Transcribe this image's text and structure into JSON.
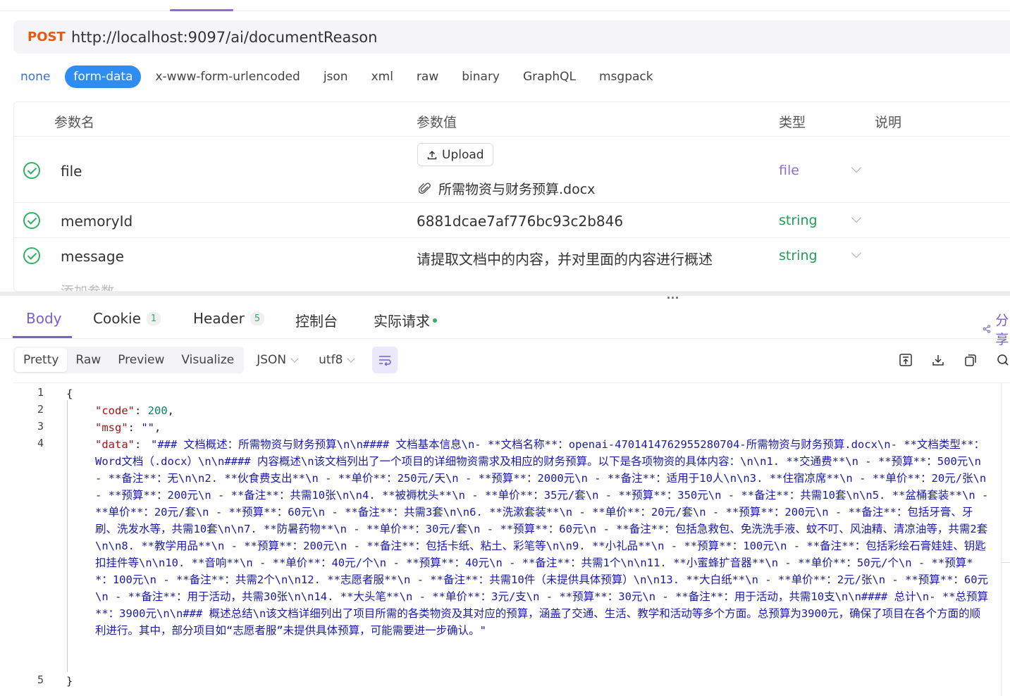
{
  "request": {
    "method": "POST",
    "url": "http://localhost:9097/ai/documentReason"
  },
  "body_types": [
    "none",
    "form-data",
    "x-www-form-urlencoded",
    "json",
    "xml",
    "raw",
    "binary",
    "GraphQL",
    "msgpack"
  ],
  "active_body_type": "form-data",
  "param_table": {
    "headers": {
      "name": "参数名",
      "value": "参数值",
      "type": "类型",
      "desc": "说明"
    },
    "rows": [
      {
        "name": "file",
        "upload_label": "Upload",
        "file_name": "所需物资与财务预算.docx",
        "type": "file"
      },
      {
        "name": "memoryId",
        "value": "6881dcae7af776bc93c2b846",
        "type": "string"
      },
      {
        "name": "message",
        "value": "请提取文档中的内容，并对里面的内容进行概述",
        "type": "string"
      }
    ],
    "add_placeholder": "添加参数"
  },
  "splitter_dots": "...",
  "response_tabs": {
    "body": "Body",
    "cookie": "Cookie",
    "cookie_count": "1",
    "header": "Header",
    "header_count": "5",
    "console": "控制台",
    "actual_request": "实际请求",
    "share": "分享"
  },
  "view_modes": [
    "Pretty",
    "Raw",
    "Preview",
    "Visualize"
  ],
  "active_view": "Pretty",
  "format": "JSON",
  "encoding": "utf8",
  "icons": [
    "top-icon",
    "download-icon",
    "copy-icon",
    "search-icon",
    "share-icon",
    "wrap-icon",
    "upload-icon",
    "paperclip-icon"
  ],
  "colors": {
    "accent": "#7b5fcf",
    "method": "#e8590c",
    "active_pill": "#2f8cf0",
    "ok": "#2fb063"
  },
  "code": {
    "line_numbers": [
      "1",
      "2",
      "3",
      "4",
      "5"
    ],
    "open_brace": "{",
    "close_brace": "}",
    "code_key": "\"code\"",
    "code_value": "200",
    "msg_key": "\"msg\"",
    "msg_value": "\"\"",
    "data_key": "\"data\"",
    "data_value": "\"### 文档概述：所需物资与财务预算\\n\\n#### 文档基本信息\\n- **文档名称**：openai-4701414762955280704-所需物资与财务预算.docx\\n- **文档类型**：Word文档（.docx）\\n\\n#### 内容概述\\n该文档列出了一个项目的详细物资需求及相应的财务预算。以下是各项物资的具体内容：\\n\\n1. **交通费**\\n   - **预算**：500元\\n   - **备注**：无\\n\\n2. **伙食费支出**\\n   - **单价**：250元/天\\n   - **预算**：2000元\\n   - **备注**：适用于10人\\n\\n3. **住宿凉席**\\n   - **单价**：20元/张\\n   - **预算**：200元\\n   - **备注**：共需10张\\n\\n4. **被褥枕头**\\n   - **单价**：35元/套\\n   - **预算**：350元\\n   - **备注**：共需10套\\n\\n5. **盆桶套装**\\n   - **单价**：20元/套\\n   - **预算**：60元\\n   - **备注**：共需3套\\n\\n6. **洗漱套装**\\n   - **单价**：20元/套\\n   - **预算**：200元\\n   - **备注**：包括牙膏、牙刷、洗发水等，共需10套\\n\\n7. **防暑药物**\\n   - **单价**：30元/套\\n   - **预算**：60元\\n   - **备注**：包括急救包、免洗洗手液、蚊不叮、风油精、清凉油等，共需2套\\n\\n8. **教学用品**\\n   - **预算**：200元\\n   - **备注**：包括卡纸、粘土、彩笔等\\n\\n9. **小礼品**\\n   - **预算**：100元\\n   - **备注**：包括彩绘石膏娃娃、钥匙扣挂件等\\n\\n10. **音响**\\n    - **单价**：40元/个\\n    - **预算**：40元\\n    - **备注**：共需1个\\n\\n11. **小蜜蜂扩音器**\\n    - **单价**：50元/个\\n    - **预算**：100元\\n    - **备注**：共需2个\\n\\n12. **志愿者服**\\n    - **备注**：共需10件（未提供具体预算）\\n\\n13. **大白纸**\\n    - **单价**：2元/张\\n    - **预算**：60元\\n    - **备注**：用于活动，共需30张\\n\\n14. **大头笔**\\n    - **单价**：3元/支\\n    - **预算**：30元\\n    - **备注**：用于活动，共需10支\\n\\n#### 总计\\n- **总预算**：3900元\\n\\n### 概述总结\\n该文档详细列出了项目所需的各类物资及其对应的预算，涵盖了交通、生活、教学和活动等多个方面。总预算为3900元，确保了项目在各个方面的顺利进行。其中，部分项目如“志愿者服”未提供具体预算，可能需要进一步确认。\""
  }
}
